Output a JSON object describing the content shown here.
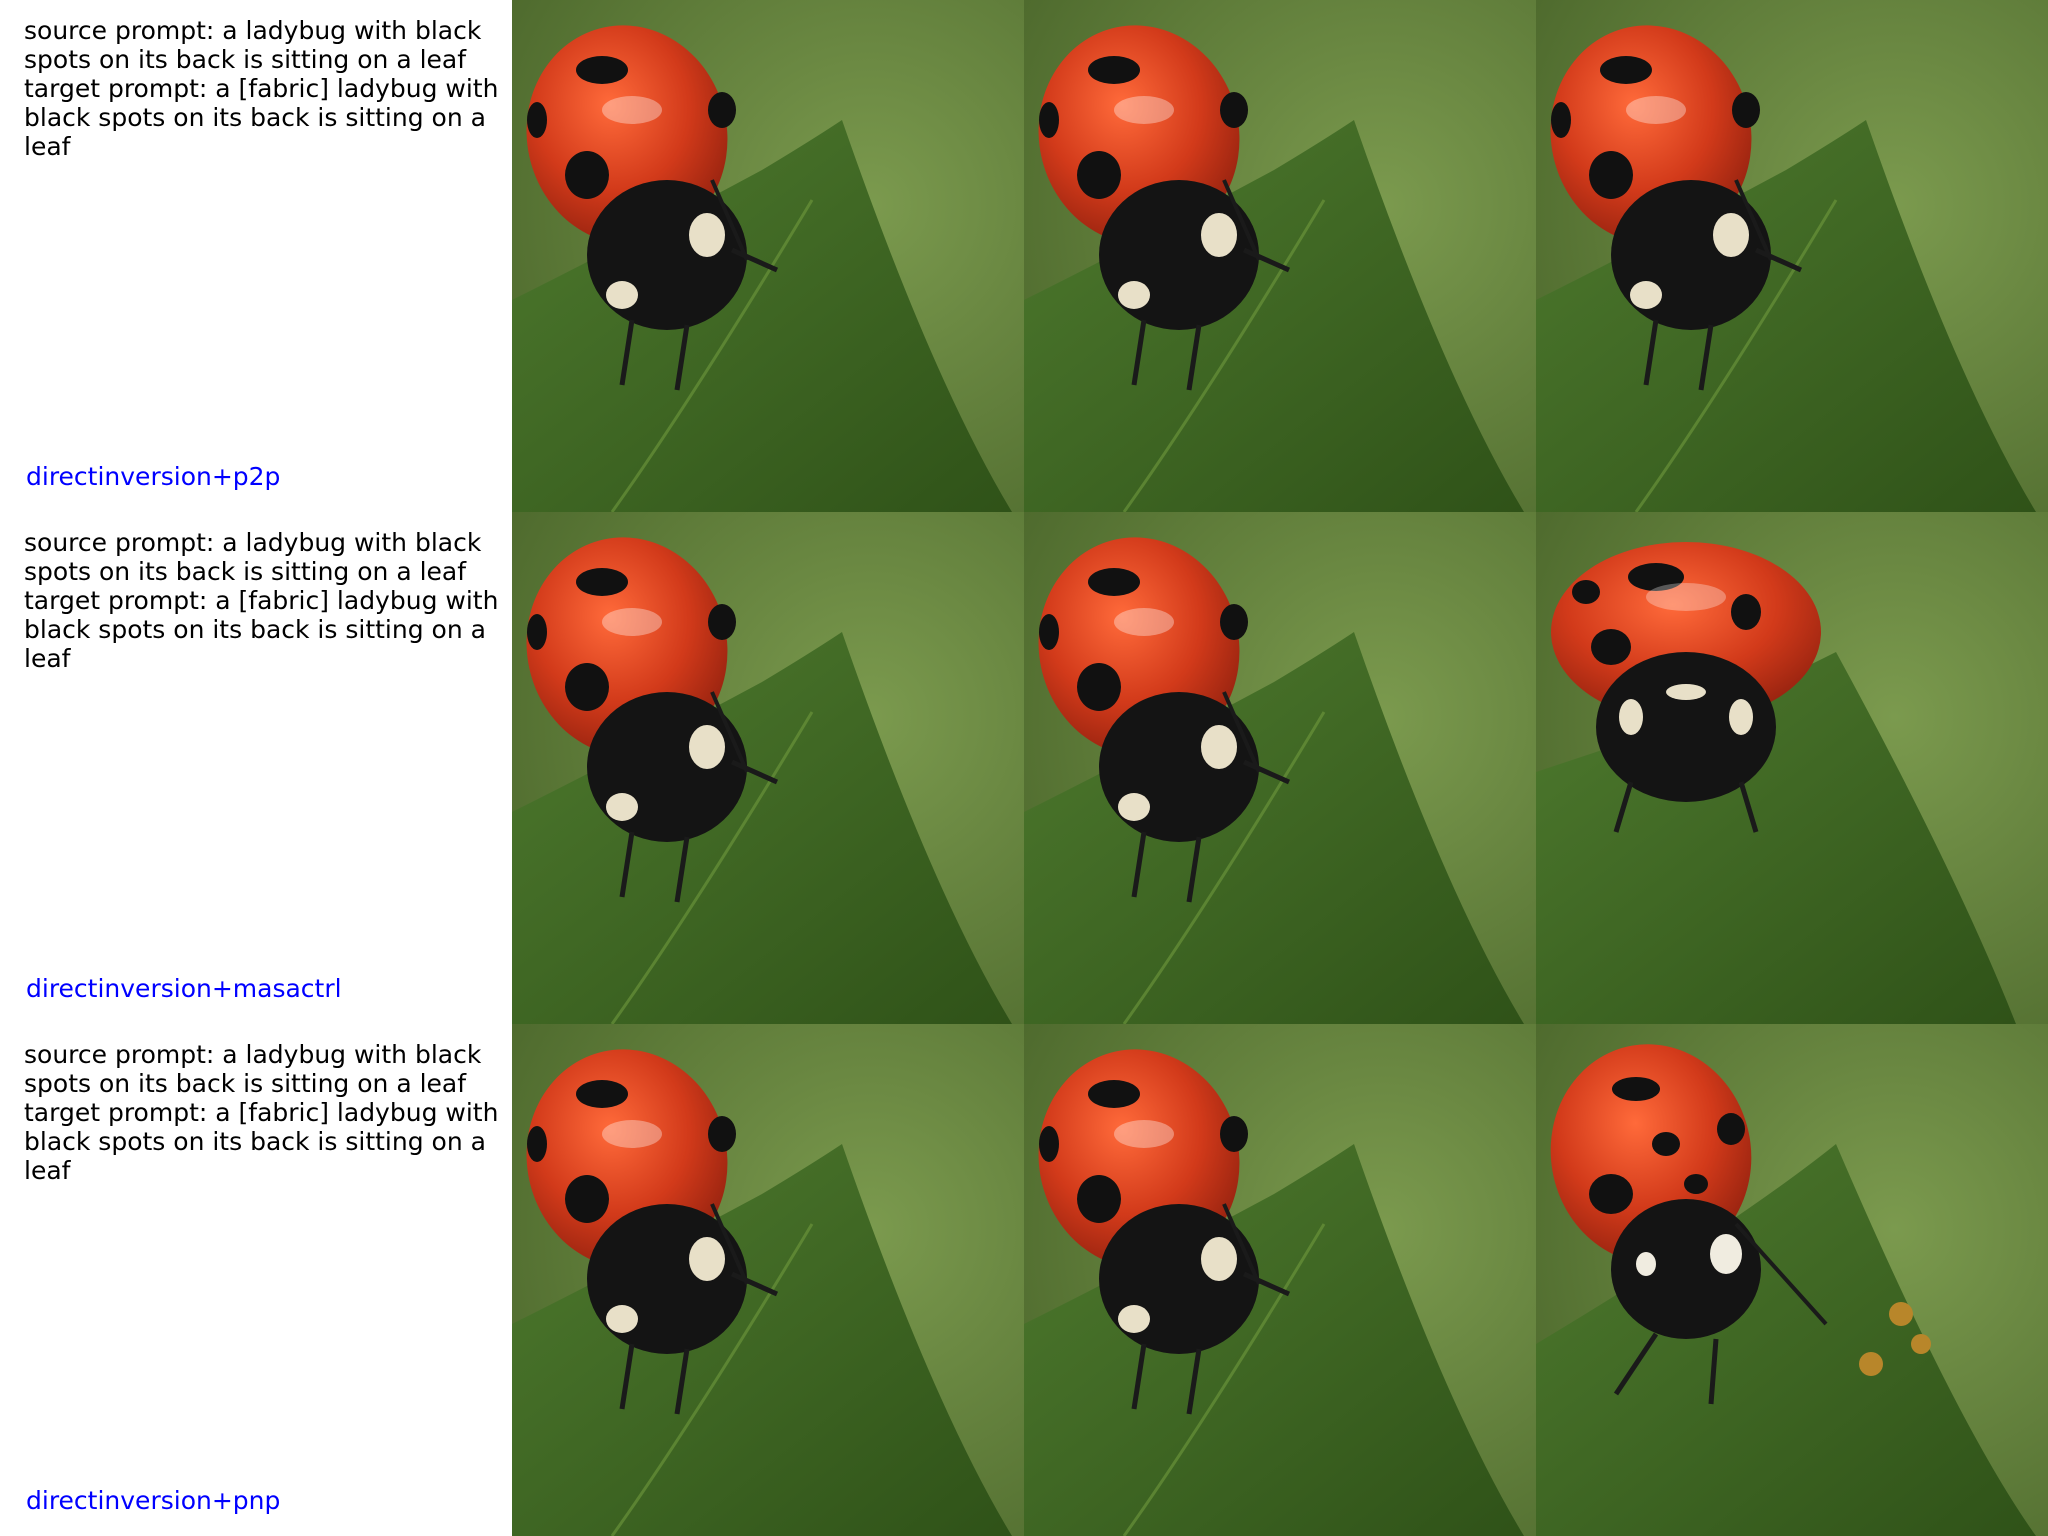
{
  "rows": [
    {
      "prompt": "source prompt: a ladybug with black\nspots on its back is sitting on a leaf\ntarget prompt: a [fabric] ladybug with\nblack spots on its back is sitting on a\nleaf",
      "method": "directinversion+p2p"
    },
    {
      "prompt": "source prompt: a ladybug with black\nspots on its back is sitting on a leaf\ntarget prompt: a [fabric] ladybug with\nblack spots on its back is sitting on a\nleaf",
      "method": "directinversion+masactrl"
    },
    {
      "prompt": "source prompt: a ladybug with black\nspots on its back is sitting on a leaf\ntarget prompt: a [fabric] ladybug with\nblack spots on its back is sitting on a\nleaf",
      "method": "directinversion+pnp"
    }
  ],
  "colors": {
    "method_label": "#0000ff",
    "prompt_text": "#000000",
    "background_green": "#5d7a3a",
    "leaf_green": "#3f6a26",
    "shell_red": "#d03a1c",
    "spot_black": "#111111"
  }
}
